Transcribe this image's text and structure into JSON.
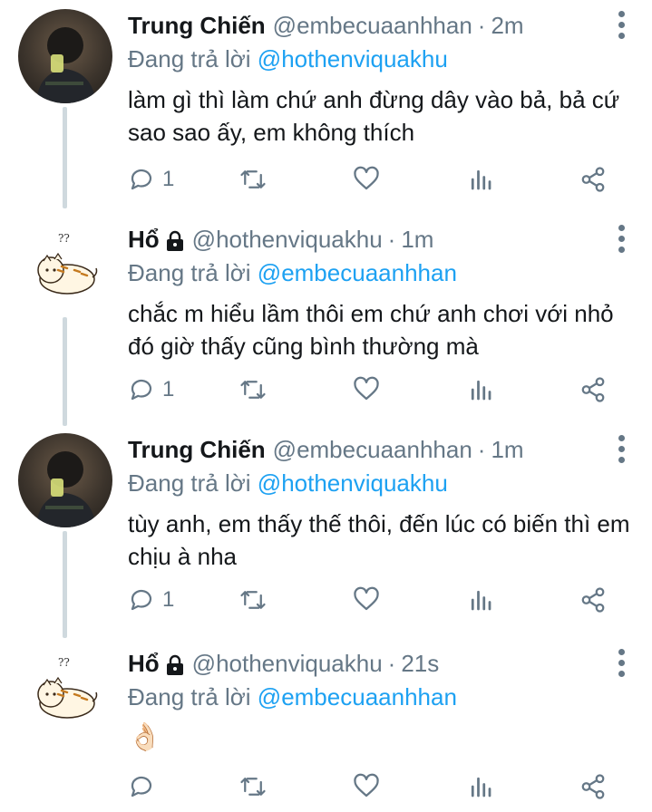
{
  "tweets": [
    {
      "name": "Trung Chiến",
      "handle": "@embecuaanhhan",
      "sep": "·",
      "time": "2m",
      "replying_prefix": "Đang trả lời",
      "replying_to": "@hothenviquakhu",
      "text": "làm gì thì làm chứ anh đừng dây vào bả, bả cứ sao sao ấy, em không thích",
      "reply_count": "1",
      "avatar": "photo"
    },
    {
      "name": "Hổ",
      "handle": "@hothenviquakhu",
      "sep": "·",
      "time": "1m",
      "replying_prefix": "Đang trả lời",
      "replying_to": "@embecuaanhhan",
      "text": "chắc m hiểu lầm thôi em chứ anh chơi với nhỏ đó giờ thấy cũng bình thường mà",
      "reply_count": "1",
      "avatar": "tiger",
      "qq": "??"
    },
    {
      "name": "Trung Chiến",
      "handle": "@embecuaanhhan",
      "sep": "·",
      "time": "1m",
      "replying_prefix": "Đang trả lời",
      "replying_to": "@hothenviquakhu",
      "text": "tùy anh, em thấy thế thôi, đến lúc có biến thì em chịu à nha",
      "reply_count": "1",
      "avatar": "photo"
    },
    {
      "name": "Hổ",
      "handle": "@hothenviquakhu",
      "sep": "·",
      "time": "21s",
      "replying_prefix": "Đang trả lời",
      "replying_to": "@embecuaanhhan",
      "text": "👌🏻",
      "reply_count": "",
      "avatar": "tiger",
      "qq": "??"
    }
  ],
  "icons": {
    "reply": "reply-icon",
    "retweet": "retweet-icon",
    "like": "heart-icon",
    "analytics": "analytics-icon",
    "share": "share-icon",
    "lock": "lock-icon",
    "more": "more-vertical-icon"
  },
  "colors": {
    "link": "#1da1f2",
    "muted": "#657786",
    "text": "#14171a"
  }
}
